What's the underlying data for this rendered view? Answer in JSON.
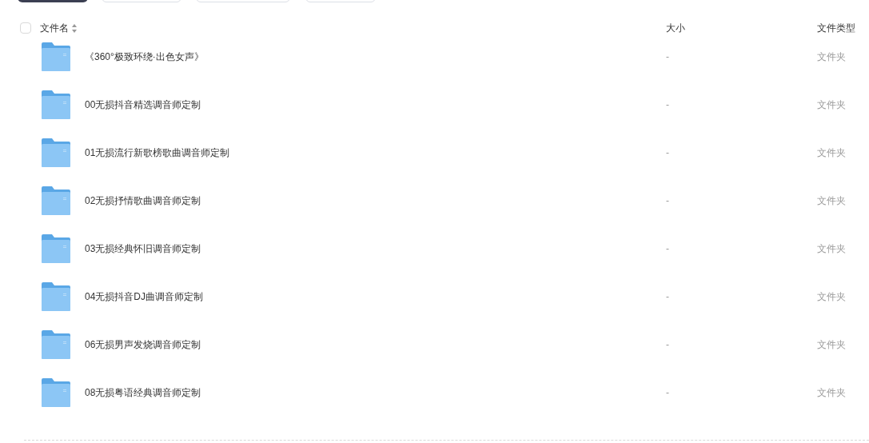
{
  "toolbar": {
    "buttons": [
      {
        "kind": "primary"
      },
      {
        "kind": "outline"
      },
      {
        "kind": "outline"
      },
      {
        "kind": "outline"
      }
    ]
  },
  "table": {
    "select_all": {
      "checked": false
    },
    "columns": [
      {
        "label": "文件名",
        "sortable": true
      },
      {
        "label": "大小",
        "sortable": false
      },
      {
        "label": "文件类型",
        "sortable": false
      }
    ],
    "rows": [
      {
        "name": "《360°极致环绕·出色女声》",
        "size": "-",
        "type": "文件夹"
      },
      {
        "name": "00无损抖音精选调音师定制",
        "size": "-",
        "type": "文件夹"
      },
      {
        "name": "01无损流行新歌榜歌曲调音师定制",
        "size": "-",
        "type": "文件夹"
      },
      {
        "name": "02无损抒情歌曲调音师定制",
        "size": "-",
        "type": "文件夹"
      },
      {
        "name": "03无损经典怀旧调音师定制",
        "size": "-",
        "type": "文件夹"
      },
      {
        "name": "04无损抖音DJ曲调音师定制",
        "size": "-",
        "type": "文件夹"
      },
      {
        "name": "06无损男声发烧调音师定制",
        "size": "-",
        "type": "文件夹"
      },
      {
        "name": "08无损粤语经典调音师定制",
        "size": "-",
        "type": "文件夹"
      }
    ]
  }
}
